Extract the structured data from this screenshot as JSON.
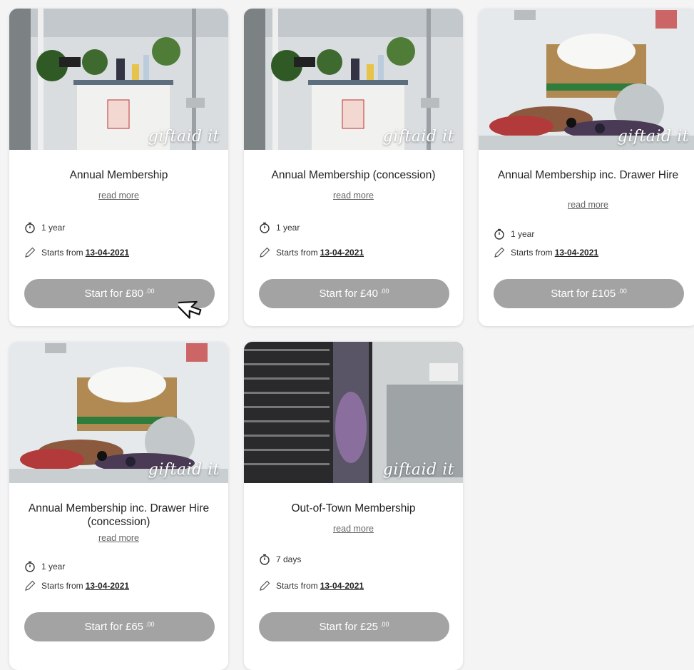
{
  "cards": [
    {
      "title": "Annual Membership",
      "read_more": "read more",
      "duration": "1 year",
      "starts_label": "Starts from",
      "start_date": "13-04-2021",
      "button": "Start for £80",
      "button_cents": ".00",
      "watermark": "giftaid it"
    },
    {
      "title": "Annual Membership (concession)",
      "read_more": "read more",
      "duration": "1 year",
      "starts_label": "Starts from",
      "start_date": "13-04-2021",
      "button": "Start for £40",
      "button_cents": ".00",
      "watermark": "giftaid it"
    },
    {
      "title": "Annual Membership inc. Drawer Hire",
      "read_more": "read more",
      "duration": "1 year",
      "starts_label": "Starts from",
      "start_date": "13-04-2021",
      "button": "Start for £105",
      "button_cents": ".00",
      "watermark": "giftaid it"
    },
    {
      "title": "Annual Membership inc. Drawer Hire (concession)",
      "read_more": "read more",
      "duration": "1 year",
      "starts_label": "Starts from",
      "start_date": "13-04-2021",
      "button": "Start for £65",
      "button_cents": ".00",
      "watermark": "giftaid it"
    },
    {
      "title": "Out-of-Town Membership",
      "read_more": "read more",
      "duration": "7 days",
      "starts_label": "Starts from",
      "start_date": "13-04-2021",
      "button": "Start for £25",
      "button_cents": ".00",
      "watermark": "giftaid it"
    }
  ],
  "colors": {
    "button": "#a3a3a3",
    "card": "#ffffff",
    "page": "#f4f4f5"
  },
  "icons": {
    "duration": "stopwatch-icon",
    "start": "pencil-icon",
    "cursor": "mouse-pointer-icon"
  }
}
